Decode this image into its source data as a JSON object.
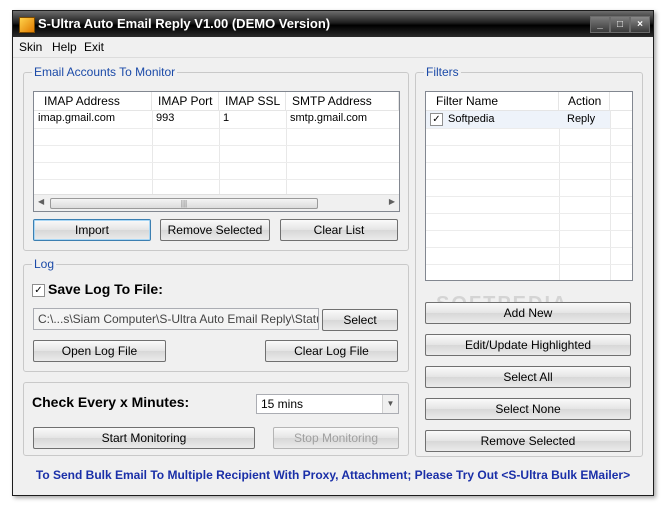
{
  "window": {
    "title": "S-Ultra Auto Email Reply V1.00 (DEMO Version)",
    "controls": [
      "minimize",
      "maximize",
      "close"
    ]
  },
  "menu": [
    "Skin",
    "Help",
    "Exit"
  ],
  "accounts": {
    "legend": "Email Accounts To Monitor",
    "columns": [
      "IMAP Address",
      "IMAP Port",
      "IMAP SSL",
      "SMTP Address"
    ],
    "rows": [
      [
        "imap.gmail.com",
        "993",
        "1",
        "smtp.gmail.com"
      ]
    ],
    "buttons": {
      "import": "Import",
      "remove": "Remove Selected",
      "clear": "Clear List"
    }
  },
  "log": {
    "legend": "Log",
    "save_label": "Save Log To File:",
    "save_checked": true,
    "path_value": "C:\\...s\\Siam Computer\\S-Ultra Auto Email Reply\\Status.log",
    "buttons": {
      "select": "Select",
      "open": "Open Log File",
      "clear": "Clear Log File"
    }
  },
  "monitor": {
    "label": "Check Every x Minutes:",
    "interval_value": "15 mins",
    "buttons": {
      "start": "Start Monitoring",
      "stop": "Stop Monitoring"
    }
  },
  "filters": {
    "legend": "Filters",
    "columns": [
      "Filter Name",
      "Action"
    ],
    "rows": [
      {
        "name": "Softpedia",
        "action": "Reply",
        "checked": true
      }
    ],
    "buttons": {
      "add": "Add New",
      "edit": "Edit/Update Highlighted",
      "select_all": "Select All",
      "select_none": "Select None",
      "remove": "Remove Selected"
    }
  },
  "promo": "To Send Bulk Email To Multiple Recipient With Proxy, Attachment; Please Try Out <S-Ultra Bulk EMailer>",
  "watermark": "SOFTPEDIA",
  "colors": {
    "legend": "#1b4aa8",
    "promo": "#1a2fa8",
    "titlebar": "#000000"
  }
}
